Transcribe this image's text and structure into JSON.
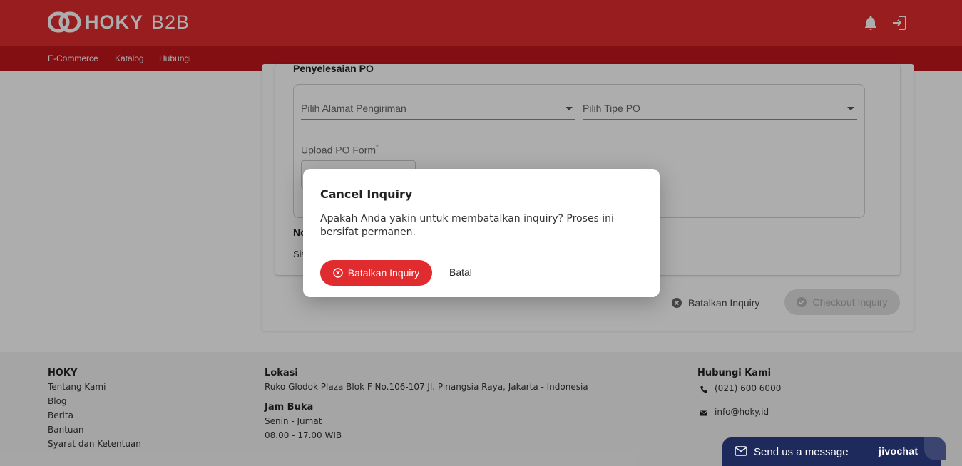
{
  "header": {
    "logo_text": "HOKY",
    "logo_sub": "B2B",
    "nav": [
      "E-Commerce",
      "Katalog",
      "Hubungi"
    ],
    "icons": [
      "bell-icon",
      "logout-icon"
    ]
  },
  "main": {
    "section_title": "Penyelesaian PO",
    "address_select": "Pilih Alamat Pengiriman",
    "po_type_select": "Pilih Tipe PO",
    "upload_label": "Upload PO Form",
    "upload_required": "*",
    "note_title": "No",
    "note_text": "Sis",
    "cancel_button": "Batalkan Inquiry",
    "checkout_button": "Checkout Inquiry"
  },
  "footer": {
    "col1": {
      "title": "HOKY",
      "links": [
        "Tentang Kami",
        "Blog",
        "Berita",
        "Bantuan",
        "Syarat dan Ketentuan"
      ]
    },
    "col2": {
      "location_title": "Lokasi",
      "address": "Ruko Glodok Plaza Blok F No.106-107 Jl. Pinangsia Raya, Jakarta - Indonesia",
      "hours_title": "Jam Buka",
      "days": "Senin - Jumat",
      "hours": "08.00 - 17.00 WIB"
    },
    "col3": {
      "title": "Hubungi Kami",
      "phone": "(021) 600 6000",
      "email": "info@hoky.id"
    }
  },
  "dialog": {
    "title": "Cancel Inquiry",
    "body": "Apakah Anda yakin untuk membatalkan inquiry? Proses ini bersifat permanen.",
    "confirm": "Batalkan Inquiry",
    "cancel": "Batal"
  },
  "chat": {
    "message": "Send us a message",
    "brand": "jivochat"
  },
  "colors": {
    "brand_red": "#e02b2f",
    "brand_red_dark": "#c3171d",
    "chat_navy": "#1e2a5c"
  }
}
